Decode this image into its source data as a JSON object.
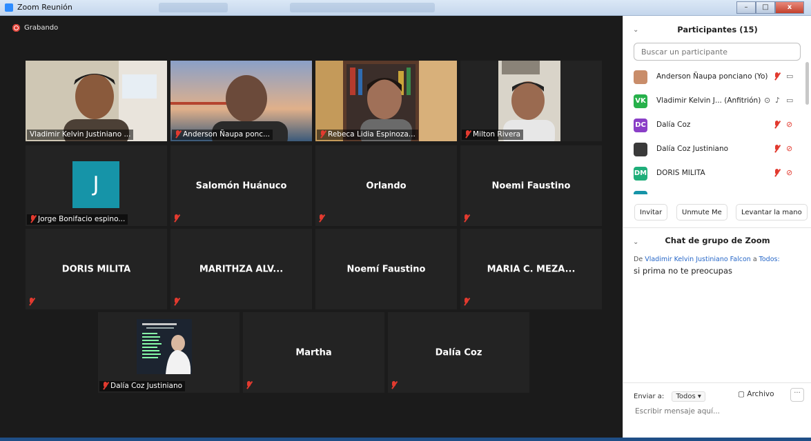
{
  "window": {
    "title": "Zoom Reunión",
    "min": "–",
    "max": "□",
    "close": "x"
  },
  "recording": {
    "label": "Grabando"
  },
  "tiles": [
    {
      "label": "Vladimir Kelvin Justiniano ...",
      "big_name": ""
    },
    {
      "label": "Anderson Ñaupa ponc...",
      "big_name": ""
    },
    {
      "label": "Rebeca Lidia Espinoza...",
      "big_name": ""
    },
    {
      "label": "Milton Rivera",
      "big_name": ""
    },
    {
      "label": "Jorge Bonifacio espino...",
      "big_name": "",
      "avatar_letter": "J"
    },
    {
      "label": "",
      "big_name": "Salomón Huánuco"
    },
    {
      "label": "",
      "big_name": "Orlando"
    },
    {
      "label": "",
      "big_name": "Noemi Faustino"
    },
    {
      "label": "",
      "big_name": "DORIS MILITA"
    },
    {
      "label": "",
      "big_name": "MARITHZA  ALV..."
    },
    {
      "label": "",
      "big_name": "Noemí Faustino"
    },
    {
      "label": "",
      "big_name": "MARIA  C. MEZA..."
    },
    {
      "label": "Dalía Coz Justiniano",
      "big_name": ""
    },
    {
      "label": "",
      "big_name": "Martha"
    },
    {
      "label": "",
      "big_name": "Dalía Coz"
    }
  ],
  "participants_panel": {
    "title": "Participantes (15)",
    "search_placeholder": "Buscar un participante",
    "items": [
      {
        "name": "Anderson Ñaupa ponciano (Yo)",
        "initials": "",
        "color": "#c98d6a"
      },
      {
        "name": "Vladimir Kelvin J...  (Anfitrión)",
        "initials": "VK",
        "color": "#27b14b"
      },
      {
        "name": "Dalía Coz",
        "initials": "DC",
        "color": "#8a3fc7"
      },
      {
        "name": "Dalía Coz Justiniano",
        "initials": "",
        "color": "#3a3a3a"
      },
      {
        "name": "DORIS MILITA",
        "initials": "DM",
        "color": "#1fae7a"
      }
    ],
    "buttons": {
      "invite": "Invitar",
      "unmute": "Unmute Me",
      "raise_hand": "Levantar la mano"
    }
  },
  "chat": {
    "title": "Chat de grupo de Zoom",
    "meta_from": "De",
    "meta_sender": "Vladimir Kelvin Justiniano Falcon",
    "meta_to": "a",
    "meta_target": "Todos:",
    "message": "si prima no te preocupas",
    "send_to_label": "Enviar a:",
    "send_to_value": "Todos",
    "file_label": "Archivo",
    "more": "···",
    "input_placeholder": "Escribir mensaje aquí..."
  }
}
